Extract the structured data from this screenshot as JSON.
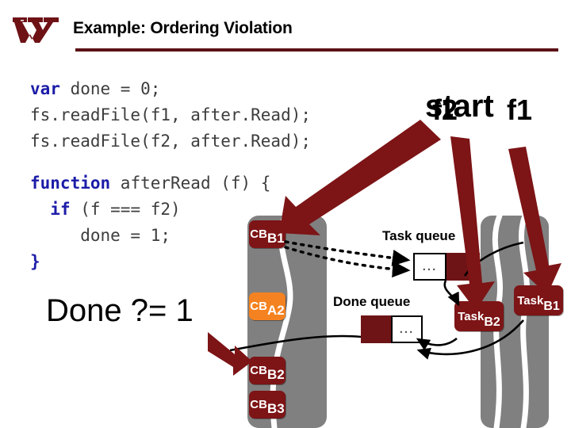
{
  "header": {
    "logo_alt": "Virginia Tech VT logo",
    "title": "Example: Ordering Violation",
    "rule_color": "#5a1216"
  },
  "code": {
    "lines": [
      {
        "tokens": [
          {
            "t": "var",
            "kw": true
          },
          {
            "t": " done = 0;",
            "kw": false
          }
        ]
      },
      {
        "tokens": [
          {
            "t": "fs.readFile(f1, after.Read);",
            "kw": false
          }
        ]
      },
      {
        "tokens": [
          {
            "t": "fs.readFile(f2, after.Read);",
            "kw": false
          }
        ]
      },
      {
        "tokens": [
          {
            "t": "",
            "kw": false
          }
        ]
      },
      {
        "tokens": [
          {
            "t": "function",
            "kw": true
          },
          {
            "t": " afterRead (f) {",
            "kw": false
          }
        ]
      },
      {
        "tokens": [
          {
            "t": "  ",
            "kw": false
          },
          {
            "t": "if",
            "kw": true
          },
          {
            "t": " (f === f2)",
            "kw": false
          }
        ]
      },
      {
        "tokens": [
          {
            "t": "     done = 1;",
            "kw": false
          }
        ]
      },
      {
        "tokens": [
          {
            "t": "}",
            "kw": true
          }
        ]
      }
    ],
    "keyword_color": "#1c1ca8",
    "text_color": "#3d3d3d"
  },
  "annotations": {
    "done_check": "Done ?= 1",
    "start_word": "start",
    "file_label_2": "f2",
    "file_label_1": "f1"
  },
  "diagram": {
    "callback_column_left": {
      "chips": [
        {
          "main": "CB",
          "sub": "B1",
          "color": "#7d1416"
        },
        {
          "main": "CB",
          "sub": "A2",
          "color": "#f58220"
        },
        {
          "main": "CB",
          "sub": "B2",
          "color": "#7d1416"
        },
        {
          "main": "CB",
          "sub": "B3",
          "color": "#7d1416"
        }
      ]
    },
    "task_chips": [
      {
        "main": "Task",
        "sub": "B2",
        "color": "#7d1416"
      },
      {
        "main": "Task",
        "sub": "B1",
        "color": "#7d1416"
      }
    ],
    "task_queue": {
      "label": "Task queue",
      "ellipsis": "...",
      "cells": [
        "empty",
        "filled",
        "filled"
      ]
    },
    "done_queue": {
      "label": "Done queue",
      "ellipsis": "...",
      "cells": [
        "filled",
        "filled",
        "empty"
      ]
    },
    "colors": {
      "maroon": "#7d1416",
      "dark_maroon": "#6e1416",
      "orange": "#f58220",
      "gray_column": "#808080",
      "wave": "#ffffff"
    }
  }
}
